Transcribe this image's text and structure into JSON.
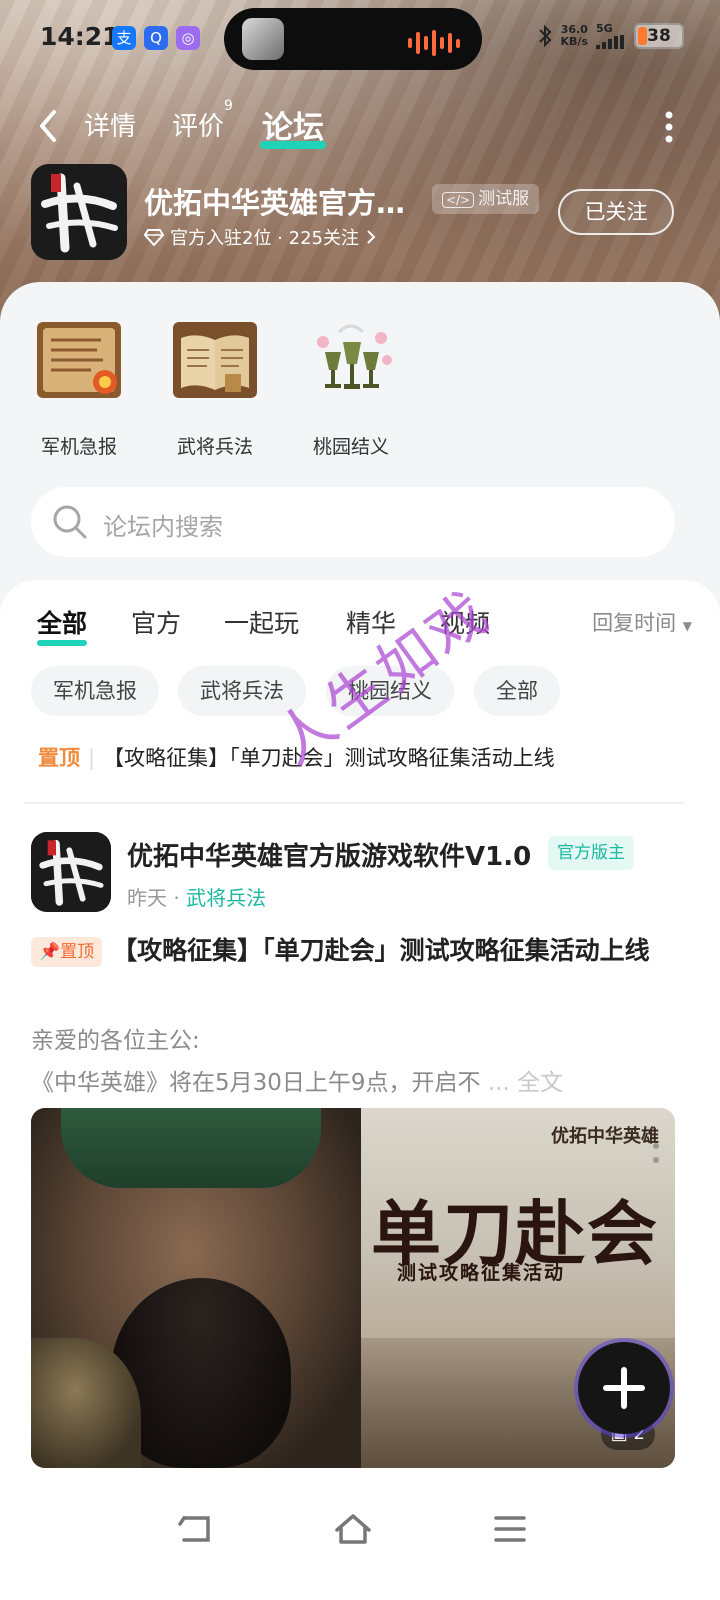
{
  "status_bar": {
    "time": "14:21",
    "app_icons": [
      {
        "name": "alipay-icon",
        "glyph": "支",
        "color": "#1677ff"
      },
      {
        "name": "qq-browser-icon",
        "glyph": "Q",
        "color": "#2b6cf0"
      },
      {
        "name": "app-icon",
        "glyph": "◎",
        "color": "#9b6cf0"
      }
    ],
    "speed_value": "36.0",
    "speed_unit": "KB/s",
    "network": "5G",
    "battery": "38"
  },
  "nav": {
    "tabs": [
      {
        "label": "详情"
      },
      {
        "label": "评价"
      },
      {
        "label": "论坛"
      }
    ],
    "review_count": "9",
    "active_tab": "论坛"
  },
  "app": {
    "title": "优拓中华英雄官方…",
    "badge": "测试服",
    "meta": "官方入驻2位 · 225关注",
    "follow_label": "已关注"
  },
  "categories": [
    {
      "label": "军机急报",
      "icon": "scroll-icon"
    },
    {
      "label": "武将兵法",
      "icon": "book-icon"
    },
    {
      "label": "桃园结义",
      "icon": "goblet-icon"
    }
  ],
  "search": {
    "placeholder": "论坛内搜索"
  },
  "feed_tabs": [
    {
      "label": "全部"
    },
    {
      "label": "官方"
    },
    {
      "label": "一起玩"
    },
    {
      "label": "精华"
    },
    {
      "label": "视频"
    }
  ],
  "sort_label": "回复时间",
  "chips": [
    {
      "label": "军机急报"
    },
    {
      "label": "武将兵法"
    },
    {
      "label": "桃园结义"
    },
    {
      "label": "全部"
    }
  ],
  "pinned": {
    "tag": "置顶",
    "text": "【攻略征集】「单刀赴会」测试攻略征集活动上线"
  },
  "post": {
    "author": "优拓中华英雄官方版游戏软件V1.0",
    "author_badge": "官方版主",
    "time": "昨天",
    "topic": "武将兵法",
    "pin_tag": "置顶",
    "title": "【攻略征集】「单刀赴会」测试攻略征集活动上线",
    "body_line1": "亲爱的各位主公:",
    "body_line2": "《中华英雄》将在5月30日上午9点，开启不",
    "body_more": "... 全文",
    "image_title": "单刀赴会",
    "image_subtitle": "测试攻略征集活动",
    "image_logo": "优拓中华英雄",
    "image_count": "2"
  },
  "watermark": "人生如戏",
  "colors": {
    "accent": "#1ed3b7",
    "pin": "#f06b2d",
    "watermark": "#b04cd6"
  }
}
